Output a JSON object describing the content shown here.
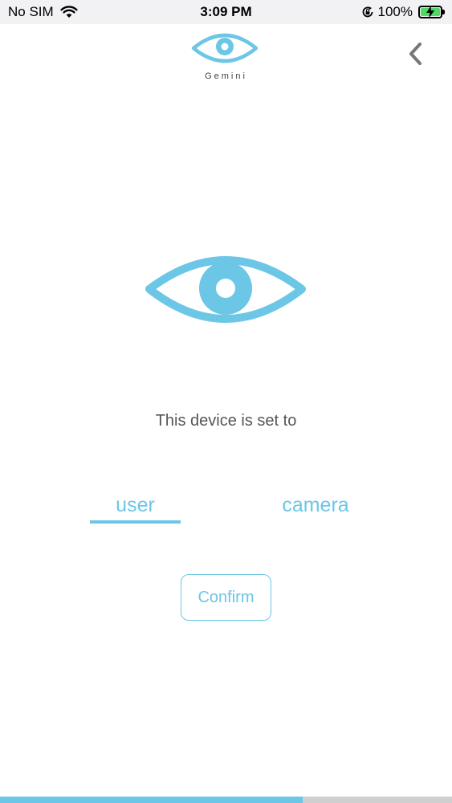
{
  "status_bar": {
    "carrier": "No SIM",
    "time": "3:09 PM",
    "battery_percent": "100%",
    "wifi_icon": "wifi-icon",
    "orientation_lock_icon": "orientation-lock-icon",
    "battery_icon": "battery-charging-icon"
  },
  "header": {
    "brand": "Gemini",
    "logo_icon": "eye-icon",
    "back_icon": "chevron-left-icon"
  },
  "main": {
    "hero_icon": "eye-icon",
    "prompt": "This device is set to",
    "options": [
      {
        "label": "user",
        "selected": true
      },
      {
        "label": "camera",
        "selected": false
      }
    ],
    "confirm_label": "Confirm"
  },
  "progress": {
    "fraction": 0.67
  },
  "colors": {
    "accent": "#6cc6e6",
    "text_gray": "#555555",
    "status_bg": "#f2f2f4",
    "battery_green": "#4cd964",
    "progress_track": "#cfcfcf"
  }
}
